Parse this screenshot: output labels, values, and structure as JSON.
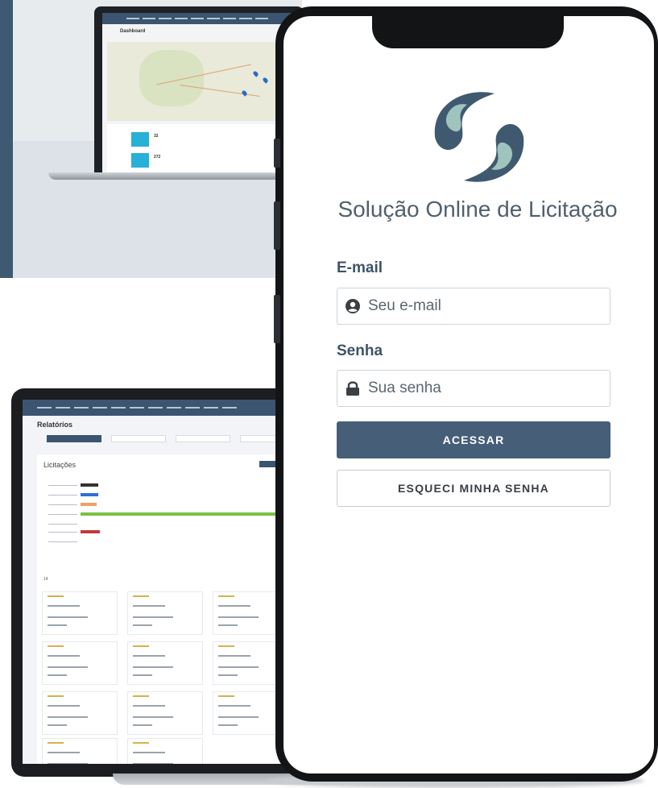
{
  "login": {
    "app_title": "Solução Online de Licitação",
    "email_label": "E-mail",
    "email_placeholder": "Seu e-mail",
    "password_label": "Senha",
    "password_placeholder": "Sua senha",
    "submit_label": "ACESSAR",
    "forgot_label": "ESQUECI MINHA SENHA",
    "icons": {
      "email": "user-circle-icon",
      "password": "lock-icon"
    }
  },
  "laptop": {
    "page_title": "Dashboard",
    "stat_1_value": "32",
    "stat_2_value": "272"
  },
  "tablet": {
    "page_title": "Relatórios",
    "panel_title": "Licitações",
    "metric_value": "14"
  },
  "colors": {
    "brand_dark": "#3b5470",
    "button_primary": "#465e78",
    "label": "#3e536a",
    "logo_dark": "#3f5a70",
    "logo_light": "#9ec4bd"
  }
}
